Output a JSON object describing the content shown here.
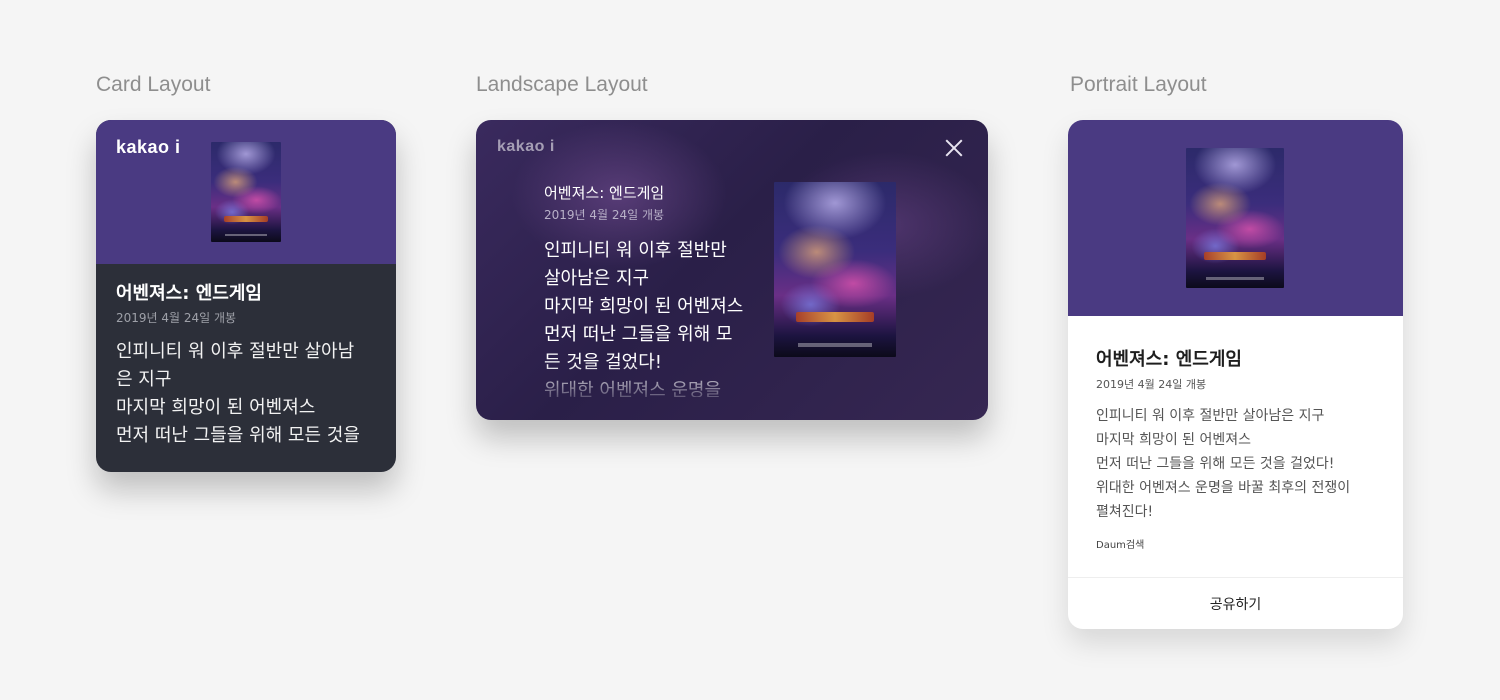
{
  "labels": {
    "card": "Card Layout",
    "landscape": "Landscape Layout",
    "portrait": "Portrait Layout"
  },
  "brand": "kakao i",
  "movie": {
    "title": "어벤져스: 엔드게임",
    "release": "2019년 4월 24일 개봉"
  },
  "card": {
    "desc_lines": [
      "인피니티 워 이후 절반만 살아남",
      "은 지구",
      "마지막 희망이 된 어벤져스",
      "먼저 떠난 그들을 위해 모든 것을"
    ]
  },
  "landscape": {
    "desc_lines": [
      "인피니티 워 이후 절반만",
      "살아남은 지구",
      "마지막 희망이 된 어벤져스",
      "먼저 떠난 그들을 위해 모",
      "든 것을 걸었다!",
      "위대한 어벤져스 운명을"
    ]
  },
  "portrait": {
    "desc_lines": [
      "인피니티 워 이후 절반만 살아남은 지구",
      "마지막 희망이 된 어벤져스",
      "먼저 떠난 그들을 위해 모든 것을 걸었다!",
      "위대한 어벤져스 운명을 바꿀 최후의 전쟁이",
      "펼쳐진다!"
    ],
    "source": "Daum검색",
    "share_label": "공유하기"
  },
  "colors": {
    "header_purple": "#4a3a82",
    "card_dark": "#2c2f39",
    "page_bg": "#f5f5f5"
  },
  "icons": {
    "close": "close-icon",
    "poster": "movie-poster-image"
  }
}
